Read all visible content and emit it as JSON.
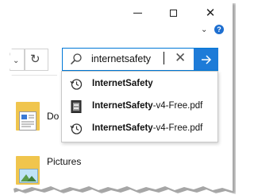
{
  "window": {
    "controls": [
      "minimize",
      "maximize",
      "close"
    ],
    "help_icon": "?"
  },
  "search": {
    "value": "internetsafety",
    "suggestions": [
      {
        "icon": "history-icon",
        "bold": "InternetSafety",
        "rest": ""
      },
      {
        "icon": "pdf-file-icon",
        "bold": "InternetSafety",
        "rest": "-v4-Free.pdf"
      },
      {
        "icon": "history-icon",
        "bold": "InternetSafety",
        "rest": "-v4-Free.pdf"
      }
    ]
  },
  "content": {
    "items": [
      {
        "label": "Do"
      },
      {
        "label": "Pictures"
      }
    ]
  },
  "colors": {
    "accent": "#1e7bd8",
    "search_border": "#0078d7",
    "folder": "#f0c54d"
  }
}
